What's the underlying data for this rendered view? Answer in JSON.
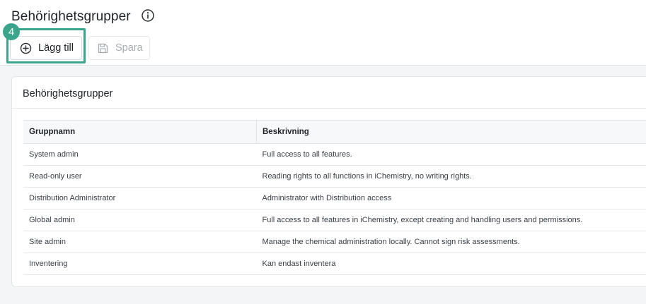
{
  "header": {
    "title": "Behörighetsgrupper",
    "add_label": "Lägg till",
    "save_label": "Spara",
    "step_number": "4"
  },
  "colors": {
    "highlight": "#3aa58a",
    "disabled_text": "#a9adb1"
  },
  "icons": {
    "info": "info-icon",
    "add": "plus-circle-icon",
    "save": "floppy-disk-icon"
  },
  "card": {
    "title": "Behörighetsgrupper",
    "columns": [
      "Gruppnamn",
      "Beskrivning"
    ],
    "rows": [
      {
        "name": "System admin",
        "description": "Full access to all features."
      },
      {
        "name": "Read-only user",
        "description": "Reading rights to all functions in iChemistry, no writing rights."
      },
      {
        "name": "Distribution Administrator",
        "description": "Administrator with Distribution access"
      },
      {
        "name": "Global admin",
        "description": "Full access to all features in iChemistry, except creating and handling users and permissions."
      },
      {
        "name": "Site admin",
        "description": "Manage the chemical administration locally. Cannot sign risk assessments."
      },
      {
        "name": "Inventering",
        "description": "Kan endast inventera"
      }
    ]
  }
}
